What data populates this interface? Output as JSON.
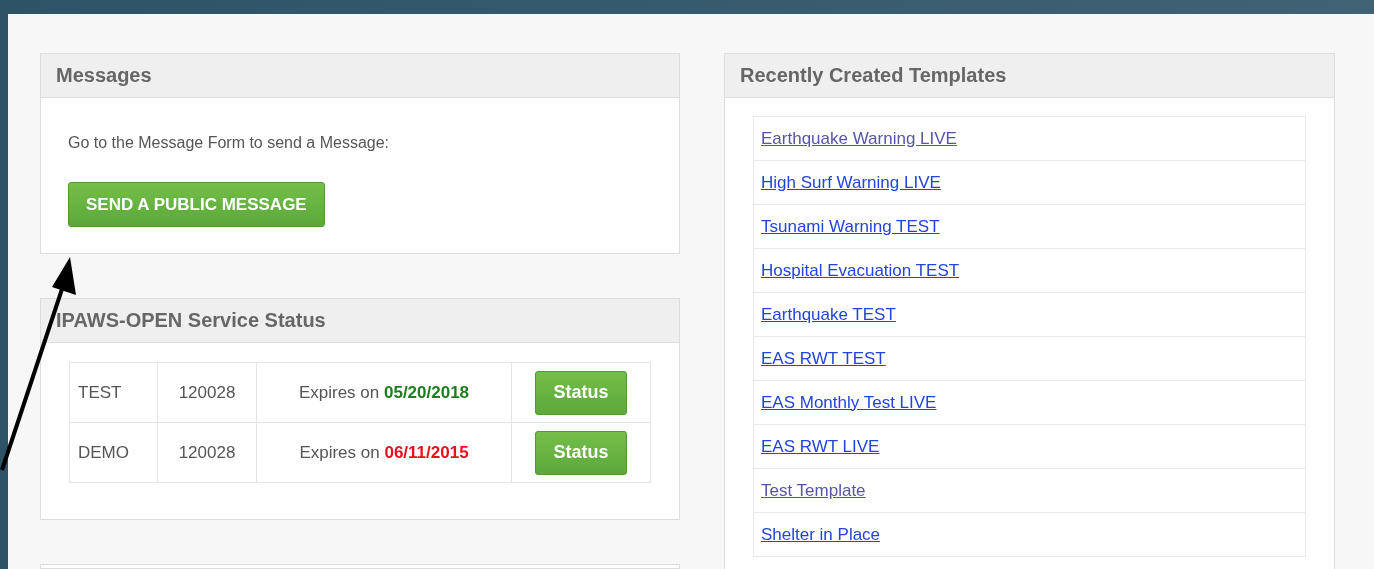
{
  "messages": {
    "title": "Messages",
    "prompt": "Go to the Message Form to send a Message:",
    "button": "SEND A PUBLIC MESSAGE"
  },
  "service_status": {
    "title": "IPAWS-OPEN Service Status",
    "rows": [
      {
        "environment": "TEST",
        "id": "120028",
        "expires_label": "Expires on",
        "date": "05/20/2018",
        "expired": false,
        "button": "Status"
      },
      {
        "environment": "DEMO",
        "id": "120028",
        "expires_label": "Expires on",
        "date": "06/11/2015",
        "expired": true,
        "button": "Status"
      }
    ]
  },
  "templates": {
    "title": "Recently Created Templates",
    "items": [
      {
        "label": "Earthquake Warning LIVE",
        "visited": true
      },
      {
        "label": "High Surf Warning LIVE",
        "visited": false
      },
      {
        "label": "Tsunami Warning TEST",
        "visited": false
      },
      {
        "label": "Hospital Evacuation TEST",
        "visited": false
      },
      {
        "label": "Earthquake TEST",
        "visited": false
      },
      {
        "label": "EAS RWT TEST",
        "visited": false
      },
      {
        "label": "EAS Monthly Test LIVE",
        "visited": false
      },
      {
        "label": "EAS RWT LIVE",
        "visited": false
      },
      {
        "label": "Test Template",
        "visited": true
      },
      {
        "label": "Shelter in Place",
        "visited": false
      }
    ]
  }
}
